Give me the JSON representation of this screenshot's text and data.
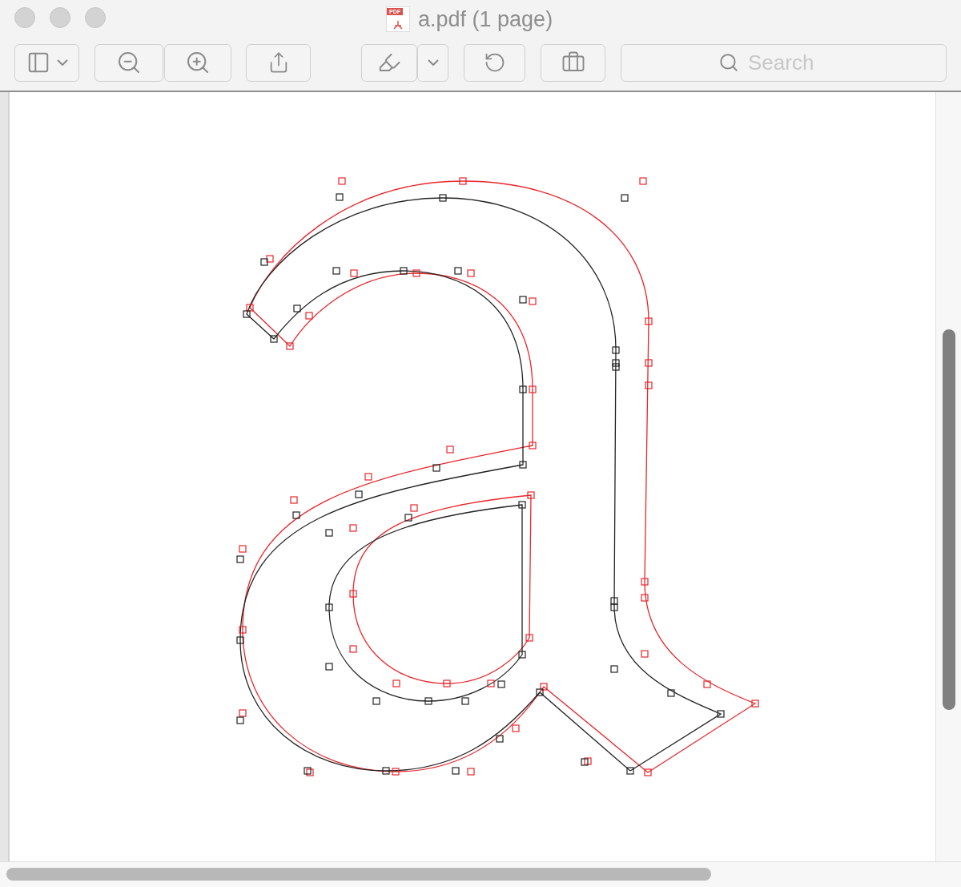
{
  "window": {
    "title": "a.pdf (1 page)",
    "file_icon_label": "PDF"
  },
  "toolbar": {
    "search": {
      "placeholder": "Search"
    }
  }
}
